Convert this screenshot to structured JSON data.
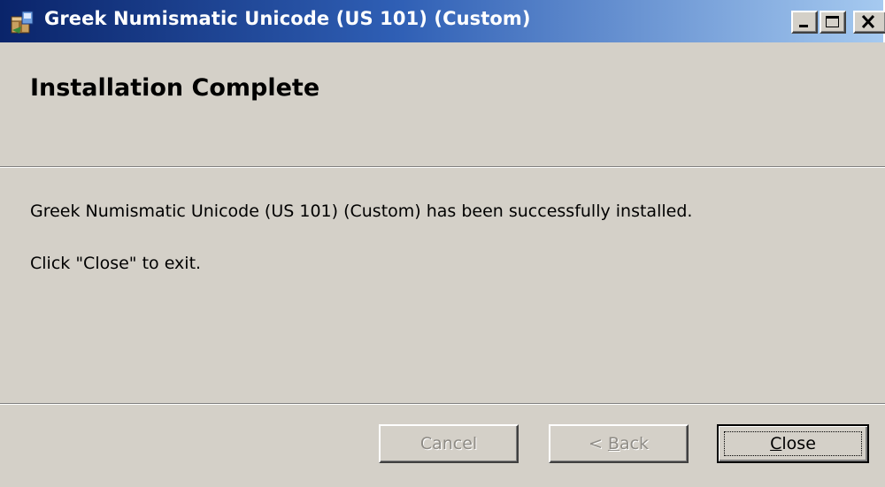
{
  "window": {
    "title": "Greek Numismatic Unicode (US 101) (Custom)",
    "icon": "installer-icon",
    "controls": [
      "minimize-icon",
      "maximize-icon",
      "close-icon"
    ]
  },
  "header": {
    "title": "Installation Complete"
  },
  "body": {
    "message": "Greek Numismatic Unicode (US 101) (Custom) has been successfully installed.",
    "instruction": "Click \"Close\" to exit."
  },
  "buttons": {
    "cancel": {
      "label": "Cancel",
      "enabled": false
    },
    "back": {
      "label_prefix": "< ",
      "label_mnemonic": "B",
      "label_rest": "ack",
      "enabled": false
    },
    "close": {
      "label_mnemonic": "C",
      "label_rest": "lose",
      "enabled": true,
      "default": true
    }
  },
  "colors": {
    "titlebar_start": "#0a246a",
    "titlebar_end": "#a6caf0",
    "face": "#d4d0c8",
    "disabled_text": "#8e8b85"
  }
}
